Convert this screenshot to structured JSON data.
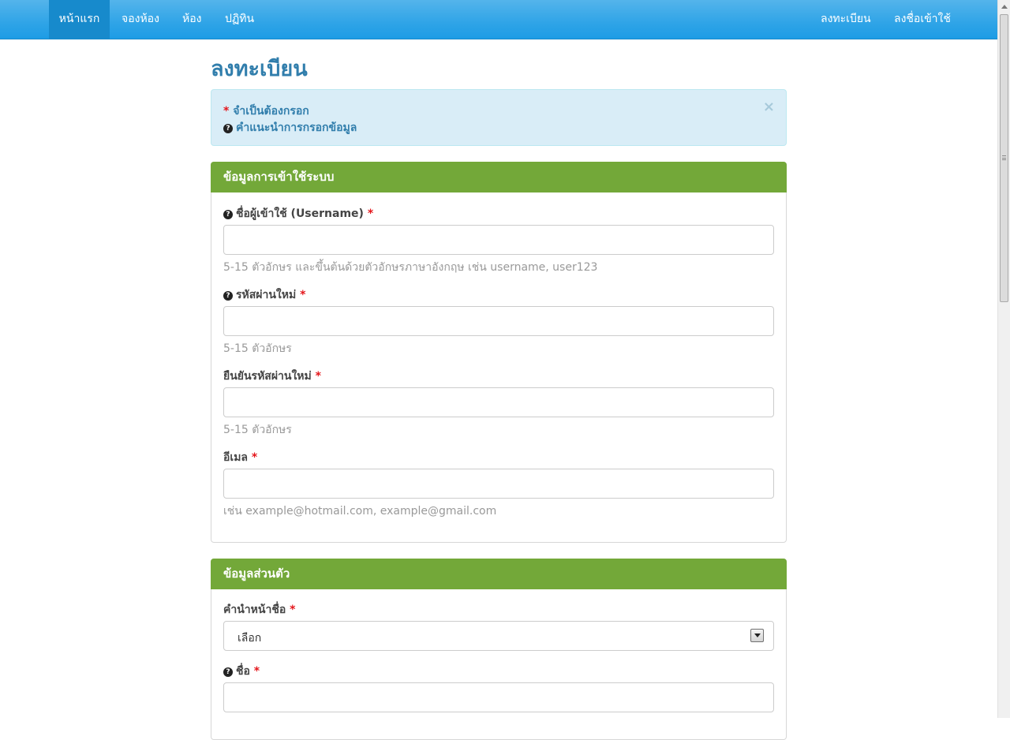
{
  "navbar": {
    "left_items": [
      "หน้าแรก",
      "จองห้อง",
      "ห้อง",
      "ปฏิทิน"
    ],
    "right_items": [
      "ลงทะเบียน",
      "ลงชื่อเข้าใช้"
    ],
    "active": "หน้าแรก"
  },
  "page": {
    "title": "ลงทะเบียน"
  },
  "alert": {
    "required_mark": "*",
    "required_text": "จำเป็นต้องกรอก",
    "help_icon": "?",
    "help_text": "คำแนะนำการกรอกข้อมูล",
    "close": "×"
  },
  "login_panel": {
    "title": "ข้อมูลการเข้าใช้ระบบ",
    "username": {
      "label": "ชื่อผู้เข้าใช้ (Username)",
      "value": "",
      "help": "5-15 ตัวอักษร และขึ้นต้นด้วยตัวอักษรภาษาอังกฤษ เช่น username, user123"
    },
    "password": {
      "label": "รหัสผ่านใหม่",
      "value": "",
      "help": "5-15 ตัวอักษร"
    },
    "confirm_password": {
      "label": "ยืนยันรหัสผ่านใหม่",
      "value": "",
      "help": "5-15 ตัวอักษร"
    },
    "email": {
      "label": "อีเมล",
      "value": "",
      "help": "เช่น example@hotmail.com, example@gmail.com"
    }
  },
  "personal_panel": {
    "title": "ข้อมูลส่วนตัว",
    "prefix": {
      "label": "คำนำหน้าชื่อ",
      "selected": "เลือก"
    },
    "first_name": {
      "label": "ชื่อ",
      "value": ""
    }
  },
  "colors": {
    "navbar": "#2fa4e7",
    "panel_heading": "#73a839",
    "title": "#317eac",
    "alert_bg": "#d9edf7",
    "required": "#e4161b"
  }
}
